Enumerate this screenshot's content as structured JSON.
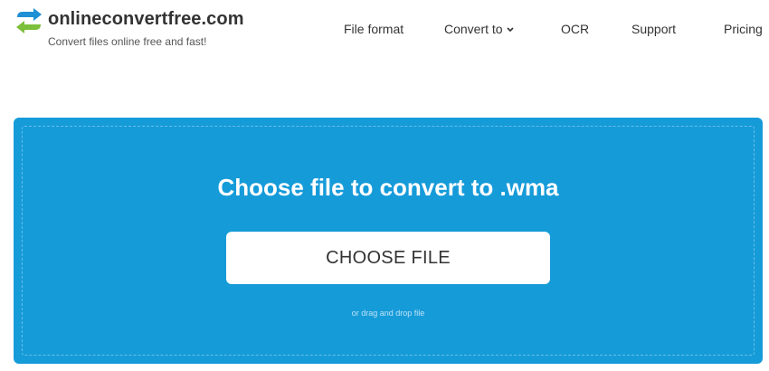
{
  "header": {
    "brand": "onlineconvertfree.com",
    "tagline": "Convert files online free and fast!",
    "logo_icon": "convert-arrows-logo"
  },
  "nav": {
    "file_format": "File format",
    "convert_to": "Convert to",
    "ocr": "OCR",
    "support": "Support",
    "pricing": "Pricing"
  },
  "upload": {
    "title": "Choose file to convert to .wma",
    "button_label": "CHOOSE FILE",
    "drag_hint": "or drag and drop file"
  },
  "colors": {
    "panel_background": "#169bd9",
    "logo_green": "#7cbf3a",
    "logo_blue": "#1f8fd6",
    "text_dark": "#333333"
  }
}
